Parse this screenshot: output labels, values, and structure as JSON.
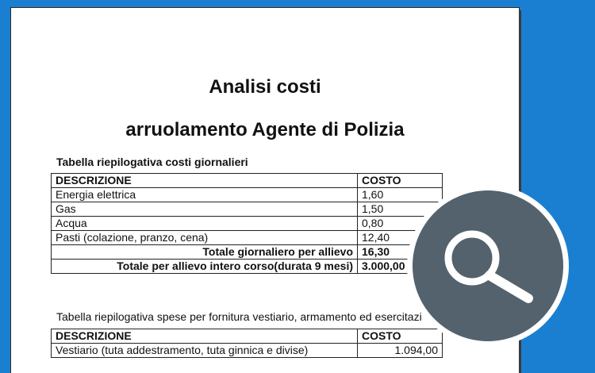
{
  "document": {
    "title_line1": "Analisi costi",
    "title_line2": "arruolamento Agente di Polizia",
    "section1_title": "Tabella riepilogativa costi giornalieri",
    "table1": {
      "header": [
        "DESCRIZIONE",
        "COSTO"
      ],
      "rows": [
        [
          "Energia  elettrica",
          "1,60"
        ],
        [
          "Gas",
          "1,50"
        ],
        [
          "Acqua",
          "0,80"
        ],
        [
          "Pasti (colazione, pranzo, cena)",
          "12,40"
        ]
      ],
      "totals": [
        [
          "Totale giornaliero per allievo",
          "16,30"
        ],
        [
          "Totale per allievo intero corso(durata 9 mesi)",
          "3.000,00"
        ]
      ]
    },
    "section2_title": "Tabella riepilogativa spese per fornitura vestiario, armamento ed esercitazi",
    "table2": {
      "header": [
        "DESCRIZIONE",
        "COSTO"
      ],
      "rows": [
        [
          "Vestiario (tuta addestramento, tuta ginnica e divise)",
          "1.094,00"
        ]
      ]
    }
  },
  "overlay": {
    "icon": "search-icon"
  },
  "colors": {
    "background": "#1a7fd1",
    "page": "#ffffff",
    "magnifier_circle": "#53626c"
  }
}
